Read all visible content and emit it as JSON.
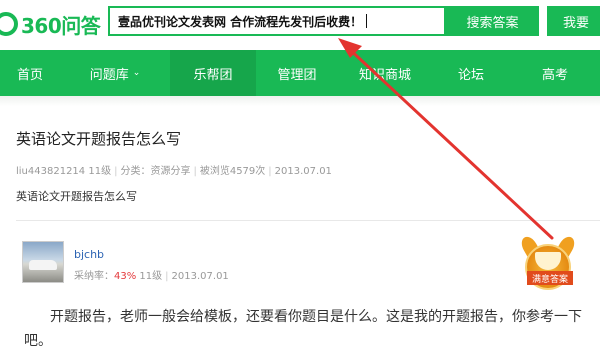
{
  "header": {
    "logo_text": "360问答",
    "search_value": "壹品优刊论文发表网   合作流程先发刊后收费！",
    "search_button": "搜索答案",
    "ask_button": "我要"
  },
  "nav": {
    "items": [
      {
        "label": "首页"
      },
      {
        "label": "问题库",
        "chevron": "⌄"
      },
      {
        "label": "乐帮团"
      },
      {
        "label": "管理团"
      },
      {
        "label": "知识商城"
      },
      {
        "label": "论坛"
      },
      {
        "label": "高考"
      }
    ]
  },
  "question": {
    "title": "英语论文开题报告怎么写",
    "user": "liu443821214",
    "level": "11级",
    "category": "分类：资源分享",
    "views": "被浏览4579次",
    "date": "2013.07.01",
    "body": "英语论文开题报告怎么写"
  },
  "answer": {
    "username": "bjchb",
    "adoption_label": "采纳率：",
    "adoption_rate": "43%",
    "level": "11级",
    "date": "2013.07.01",
    "text": "开题报告，老师一般会给模板，还要看你题目是什么。这是我的开题报告，你参考一下吧。"
  },
  "badge": {
    "label": "满意答案"
  },
  "colors": {
    "brand_green": "#19b955",
    "active_nav": "#16a64b",
    "annotation_red": "#e3342f",
    "rate_red": "#e4393c"
  }
}
